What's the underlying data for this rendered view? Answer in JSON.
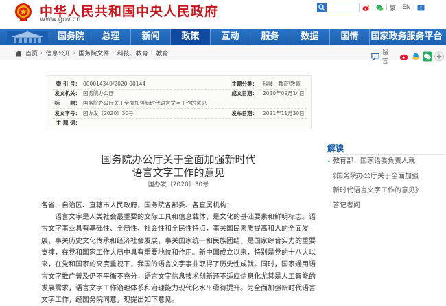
{
  "header": {
    "site_title": "中华人民共和国中央人民政府",
    "site_url": "www.gov.cn",
    "util": {
      "lang_sep": "|",
      "lang_en": "EN",
      "lang_fan": "繁",
      "lang_sep2": "|"
    },
    "brand_color": "#c8161d"
  },
  "nav": {
    "items": [
      "国务院",
      "总理",
      "新闻",
      "政策",
      "互动",
      "服务",
      "数据",
      "国情",
      "国家政务服务平台"
    ],
    "active_index": 3,
    "color": "#1b5fb0"
  },
  "breadcrumb": {
    "items": [
      "首页",
      "信息公开",
      "国务院文件",
      "科技、教育",
      "教育"
    ]
  },
  "share": {
    "comment_label": "留言"
  },
  "meta": {
    "rows": [
      {
        "label": "索 引 号：",
        "value": "000014349/2020-00144",
        "label2": "主题分类：",
        "value2": "科技、教育\\教育"
      },
      {
        "label": "发文机关：",
        "value": "国务院办公厅",
        "label2": "成文日期：",
        "value2": "2020年09月14日"
      },
      {
        "label": "标　　题：",
        "value": "国务院办公厅关于全面加强新时代语言文字工作的意见",
        "label2": "",
        "value2": ""
      },
      {
        "label": "发文字号：",
        "value": "国办发〔2020〕30号",
        "label2": "发布日期：",
        "value2": "2021年11月30日"
      },
      {
        "label": "主 题 词：",
        "value": "",
        "label2": "",
        "value2": ""
      }
    ]
  },
  "article": {
    "title_line1": "国务院办公厅关于全面加强新时代",
    "title_line2": "语言文字工作的意见",
    "doc_number": "国办发〔2020〕30号",
    "salutation": "各省、自治区、直辖市人民政府，国务院各部委、各直属机构：",
    "lines": [
      "　　语言文字是人类社会最重要的交际工具和信息载体，是文化的基础要素和鲜明标志。语",
      "言文字事业具有基础性、全局性、社会性和全民性特点，事关国民素质提高和人的全面发",
      "展，事关历史文化传承和经济社会发展，事关国家统一和民族团结，是国家综合实力的重要",
      "支撑，在党和国家工作大局中具有重要地位和作用。新中国成立以来，特别是党的十八大以",
      "来，在党和国家的高度重视下，我国的语言文字事业取得了历史性成就。同时，国家通用语",
      "言文字推广普及仍不平衡不充分，语言文字信息技术创新还不适应信息化尤其是人工智能的",
      "发展需求，语言文字工作治理体系和治理能力现代化水平亟待提升。为全面加强新时代语言",
      "文字工作，经国务院同意，现提出如下意见。"
    ]
  },
  "sidebar": {
    "title": "解读",
    "links": [
      "教育部、国家语委负责人就",
      "《国务院办公厅关于全面加强",
      "新时代语言文字工作的意见》",
      "答记者问"
    ]
  }
}
